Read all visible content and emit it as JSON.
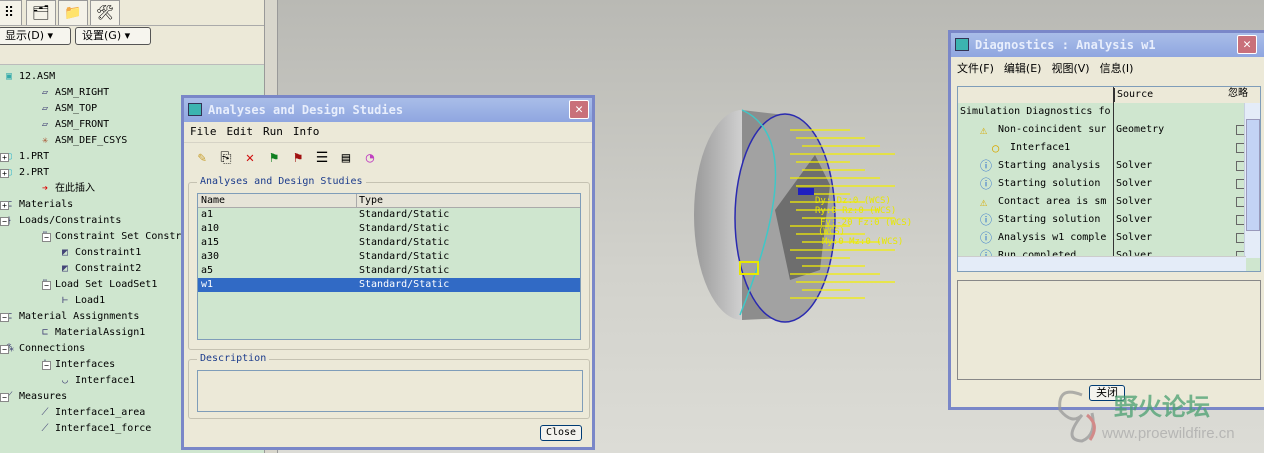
{
  "left_panel": {
    "display_btn": "显示(D) ▾",
    "settings_btn": "设置(G) ▾",
    "tree": [
      {
        "label": "12.ASM",
        "icon": "assembly-icon"
      },
      {
        "label": "ASM_RIGHT",
        "icon": "datum-plane-icon"
      },
      {
        "label": "ASM_TOP",
        "icon": "datum-plane-icon"
      },
      {
        "label": "ASM_FRONT",
        "icon": "datum-plane-icon"
      },
      {
        "label": "ASM_DEF_CSYS",
        "icon": "csys-icon"
      },
      {
        "label": "1.PRT",
        "icon": "part-icon"
      },
      {
        "label": "2.PRT",
        "icon": "part-icon"
      },
      {
        "label": "在此插入",
        "icon": "insert-arrow-icon"
      },
      {
        "label": "Materials",
        "icon": "material-icon"
      },
      {
        "label": "Loads/Constraints",
        "icon": "loads-icon"
      },
      {
        "label": "Constraint Set Constr",
        "icon": "constraint-set-icon"
      },
      {
        "label": "Constraint1",
        "icon": "constraint-icon"
      },
      {
        "label": "Constraint2",
        "icon": "constraint-icon"
      },
      {
        "label": "Load Set LoadSet1",
        "icon": "load-set-icon"
      },
      {
        "label": "Load1",
        "icon": "load-icon"
      },
      {
        "label": "Material Assignments",
        "icon": "material-icon"
      },
      {
        "label": "MaterialAssign1",
        "icon": "material-icon"
      },
      {
        "label": "Connections",
        "icon": "connections-icon"
      },
      {
        "label": "Interfaces",
        "icon": "interfaces-icon"
      },
      {
        "label": "Interface1",
        "icon": "interface-icon"
      },
      {
        "label": "Measures",
        "icon": "measure-icon"
      },
      {
        "label": "Interface1_area",
        "icon": "measure-icon"
      },
      {
        "label": "Interface1_force",
        "icon": "measure-icon"
      }
    ]
  },
  "analyses": {
    "title": "Analyses and Design Studies",
    "menu": [
      "File",
      "Edit",
      "Run",
      "Info"
    ],
    "group_label": "Analyses and Design Studies",
    "columns": [
      "Name",
      "Type"
    ],
    "rows": [
      [
        "a1",
        "Standard/Static"
      ],
      [
        "a10",
        "Standard/Static"
      ],
      [
        "a15",
        "Standard/Static"
      ],
      [
        "a30",
        "Standard/Static"
      ],
      [
        "a5",
        "Standard/Static"
      ],
      [
        "w1",
        "Standard/Static"
      ]
    ],
    "selected": "w1",
    "description_label": "Description",
    "close": "Close"
  },
  "viewport": {
    "annotations": [
      "Dy: Dz:0 (WCS)",
      "Ry:0 Rz:0 (WCS)",
      "Fy:-20 Fz:0 (WCS)",
      "(WCS)",
      "My:0 Mz:0 (WCS)"
    ]
  },
  "diagnostics": {
    "title": "Diagnostics : Analysis w1",
    "menu": [
      "文件(F)",
      "编辑(E)",
      "视图(V)",
      "信息(I)"
    ],
    "columns": [
      "",
      "Source",
      "忽略"
    ],
    "rows": [
      {
        "msg": "Simulation Diagnostics fo",
        "source": "",
        "icon": ""
      },
      {
        "msg": "Non-coincident sur",
        "source": "Geometry",
        "icon": "warning-icon"
      },
      {
        "msg": "Interface1",
        "source": "",
        "icon": "dot-icon"
      },
      {
        "msg": "Starting analysis",
        "source": "Solver",
        "icon": "info-icon"
      },
      {
        "msg": "Starting solution",
        "source": "Solver",
        "icon": "info-icon"
      },
      {
        "msg": "Contact area is sm",
        "source": "Solver",
        "icon": "warning-icon"
      },
      {
        "msg": "Starting solution",
        "source": "Solver",
        "icon": "info-icon"
      },
      {
        "msg": "Analysis w1 comple",
        "source": "Solver",
        "icon": "info-icon"
      },
      {
        "msg": "Run completed",
        "source": "Solver",
        "icon": "info-icon"
      }
    ],
    "close": "关闭"
  },
  "watermark": {
    "name": "野火论坛",
    "url": "www.proewildfire.cn"
  }
}
